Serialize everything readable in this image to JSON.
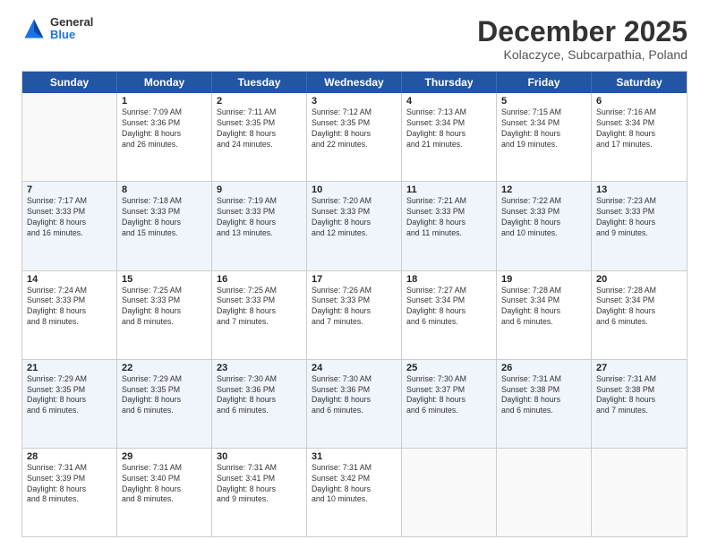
{
  "logo": {
    "general": "General",
    "blue": "Blue"
  },
  "header": {
    "month": "December 2025",
    "location": "Kolaczyce, Subcarpathia, Poland"
  },
  "days_of_week": [
    "Sunday",
    "Monday",
    "Tuesday",
    "Wednesday",
    "Thursday",
    "Friday",
    "Saturday"
  ],
  "weeks": [
    [
      {
        "day": "",
        "info": ""
      },
      {
        "day": "1",
        "info": "Sunrise: 7:09 AM\nSunset: 3:36 PM\nDaylight: 8 hours\nand 26 minutes."
      },
      {
        "day": "2",
        "info": "Sunrise: 7:11 AM\nSunset: 3:35 PM\nDaylight: 8 hours\nand 24 minutes."
      },
      {
        "day": "3",
        "info": "Sunrise: 7:12 AM\nSunset: 3:35 PM\nDaylight: 8 hours\nand 22 minutes."
      },
      {
        "day": "4",
        "info": "Sunrise: 7:13 AM\nSunset: 3:34 PM\nDaylight: 8 hours\nand 21 minutes."
      },
      {
        "day": "5",
        "info": "Sunrise: 7:15 AM\nSunset: 3:34 PM\nDaylight: 8 hours\nand 19 minutes."
      },
      {
        "day": "6",
        "info": "Sunrise: 7:16 AM\nSunset: 3:34 PM\nDaylight: 8 hours\nand 17 minutes."
      }
    ],
    [
      {
        "day": "7",
        "info": "Sunrise: 7:17 AM\nSunset: 3:33 PM\nDaylight: 8 hours\nand 16 minutes."
      },
      {
        "day": "8",
        "info": "Sunrise: 7:18 AM\nSunset: 3:33 PM\nDaylight: 8 hours\nand 15 minutes."
      },
      {
        "day": "9",
        "info": "Sunrise: 7:19 AM\nSunset: 3:33 PM\nDaylight: 8 hours\nand 13 minutes."
      },
      {
        "day": "10",
        "info": "Sunrise: 7:20 AM\nSunset: 3:33 PM\nDaylight: 8 hours\nand 12 minutes."
      },
      {
        "day": "11",
        "info": "Sunrise: 7:21 AM\nSunset: 3:33 PM\nDaylight: 8 hours\nand 11 minutes."
      },
      {
        "day": "12",
        "info": "Sunrise: 7:22 AM\nSunset: 3:33 PM\nDaylight: 8 hours\nand 10 minutes."
      },
      {
        "day": "13",
        "info": "Sunrise: 7:23 AM\nSunset: 3:33 PM\nDaylight: 8 hours\nand 9 minutes."
      }
    ],
    [
      {
        "day": "14",
        "info": "Sunrise: 7:24 AM\nSunset: 3:33 PM\nDaylight: 8 hours\nand 8 minutes."
      },
      {
        "day": "15",
        "info": "Sunrise: 7:25 AM\nSunset: 3:33 PM\nDaylight: 8 hours\nand 8 minutes."
      },
      {
        "day": "16",
        "info": "Sunrise: 7:25 AM\nSunset: 3:33 PM\nDaylight: 8 hours\nand 7 minutes."
      },
      {
        "day": "17",
        "info": "Sunrise: 7:26 AM\nSunset: 3:33 PM\nDaylight: 8 hours\nand 7 minutes."
      },
      {
        "day": "18",
        "info": "Sunrise: 7:27 AM\nSunset: 3:34 PM\nDaylight: 8 hours\nand 6 minutes."
      },
      {
        "day": "19",
        "info": "Sunrise: 7:28 AM\nSunset: 3:34 PM\nDaylight: 8 hours\nand 6 minutes."
      },
      {
        "day": "20",
        "info": "Sunrise: 7:28 AM\nSunset: 3:34 PM\nDaylight: 8 hours\nand 6 minutes."
      }
    ],
    [
      {
        "day": "21",
        "info": "Sunrise: 7:29 AM\nSunset: 3:35 PM\nDaylight: 8 hours\nand 6 minutes."
      },
      {
        "day": "22",
        "info": "Sunrise: 7:29 AM\nSunset: 3:35 PM\nDaylight: 8 hours\nand 6 minutes."
      },
      {
        "day": "23",
        "info": "Sunrise: 7:30 AM\nSunset: 3:36 PM\nDaylight: 8 hours\nand 6 minutes."
      },
      {
        "day": "24",
        "info": "Sunrise: 7:30 AM\nSunset: 3:36 PM\nDaylight: 8 hours\nand 6 minutes."
      },
      {
        "day": "25",
        "info": "Sunrise: 7:30 AM\nSunset: 3:37 PM\nDaylight: 8 hours\nand 6 minutes."
      },
      {
        "day": "26",
        "info": "Sunrise: 7:31 AM\nSunset: 3:38 PM\nDaylight: 8 hours\nand 6 minutes."
      },
      {
        "day": "27",
        "info": "Sunrise: 7:31 AM\nSunset: 3:38 PM\nDaylight: 8 hours\nand 7 minutes."
      }
    ],
    [
      {
        "day": "28",
        "info": "Sunrise: 7:31 AM\nSunset: 3:39 PM\nDaylight: 8 hours\nand 8 minutes."
      },
      {
        "day": "29",
        "info": "Sunrise: 7:31 AM\nSunset: 3:40 PM\nDaylight: 8 hours\nand 8 minutes."
      },
      {
        "day": "30",
        "info": "Sunrise: 7:31 AM\nSunset: 3:41 PM\nDaylight: 8 hours\nand 9 minutes."
      },
      {
        "day": "31",
        "info": "Sunrise: 7:31 AM\nSunset: 3:42 PM\nDaylight: 8 hours\nand 10 minutes."
      },
      {
        "day": "",
        "info": ""
      },
      {
        "day": "",
        "info": ""
      },
      {
        "day": "",
        "info": ""
      }
    ]
  ]
}
